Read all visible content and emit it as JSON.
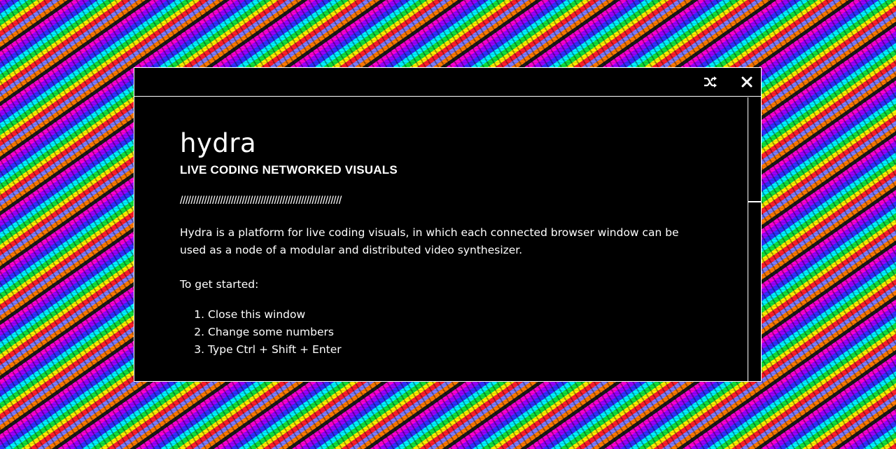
{
  "header": {
    "shuffle_icon": "shuffle-icon",
    "close_icon": "close-icon"
  },
  "intro": {
    "title": "hydra",
    "subtitle": "LIVE CODING NETWORKED VISUALS",
    "divider": "////////////////////////////////////////////////////////////",
    "description": "Hydra is a platform for live coding visuals, in which each connected browser window can be used as a node of a modular and distributed video synthesizer.",
    "get_started": "To get started:",
    "steps": [
      "Close this window",
      "Change some numbers",
      "Type Ctrl + Shift + Enter"
    ]
  },
  "colors": {
    "modal_bg": "#000000",
    "border": "#ffffff",
    "text": "#ffffff"
  }
}
